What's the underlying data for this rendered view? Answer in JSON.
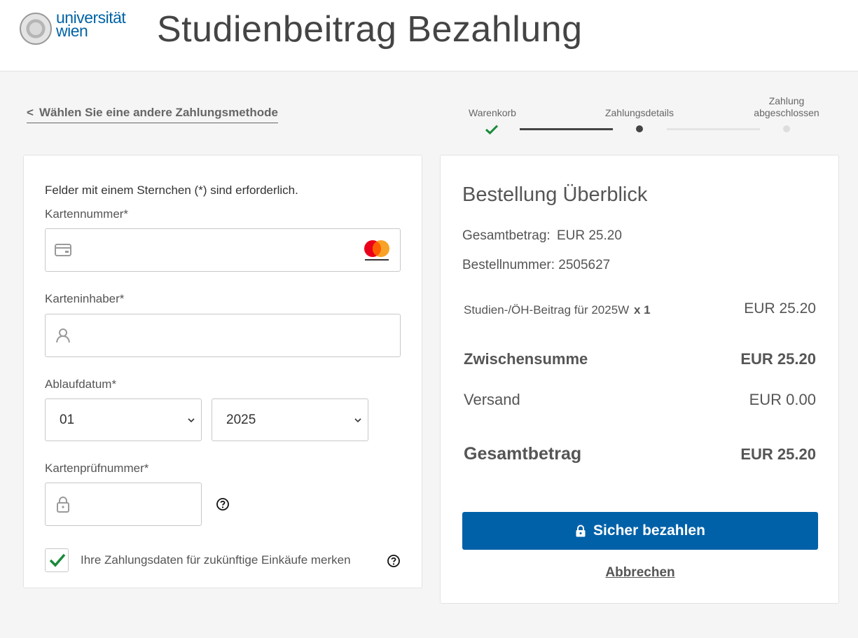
{
  "header": {
    "logo_line1": "universität",
    "logo_line2": "wien",
    "title": "Studienbeitrag Bezahlung"
  },
  "back_link": {
    "chevron": "<",
    "label": "Wählen Sie eine andere Zahlungsmethode"
  },
  "steps": [
    {
      "label": "Warenkorb",
      "state": "done"
    },
    {
      "label": "Zahlungsdetails",
      "state": "current"
    },
    {
      "label_line1": "Zahlung",
      "label_line2": "abgeschlossen",
      "state": "pending"
    }
  ],
  "form": {
    "required_note": "Felder mit einem Sternchen (*) sind erforderlich.",
    "card_number": {
      "label": "Kartennummer*",
      "value": "",
      "icon": "credit-card-icon",
      "brand": "mastercard"
    },
    "card_holder": {
      "label": "Karteninhaber*",
      "value": "",
      "icon": "user-icon"
    },
    "expiry": {
      "label": "Ablaufdatum*",
      "month": "01",
      "year": "2025"
    },
    "cvv": {
      "label": "Kartenprüfnummer*",
      "value": "",
      "icon": "lock-icon"
    },
    "remember": {
      "label": "Ihre Zahlungsdaten für zukünftige Einkäufe merken",
      "checked": true
    }
  },
  "summary": {
    "title": "Bestellung Überblick",
    "total_line_label": "Gesamtbetrag:",
    "total_line_value": "EUR 25.20",
    "order_number_label": "Bestellnummer:",
    "order_number": "2505627",
    "item": {
      "name": "Studien-/ÖH-Beitrag für 2025W",
      "qty": "x 1",
      "price": "EUR 25.20"
    },
    "subtotal": {
      "label": "Zwischensumme",
      "value": "EUR 25.20"
    },
    "shipping": {
      "label": "Versand",
      "value": "EUR 0.00"
    },
    "total": {
      "label": "Gesamtbetrag",
      "value": "EUR 25.20"
    },
    "pay_button": "Sicher bezahlen",
    "cancel": "Abbrechen"
  },
  "colors": {
    "brand_blue": "#0061a8",
    "check_green": "#1a8a3a",
    "mastercard_red": "#eb001b",
    "mastercard_orange": "#f79e1b"
  }
}
